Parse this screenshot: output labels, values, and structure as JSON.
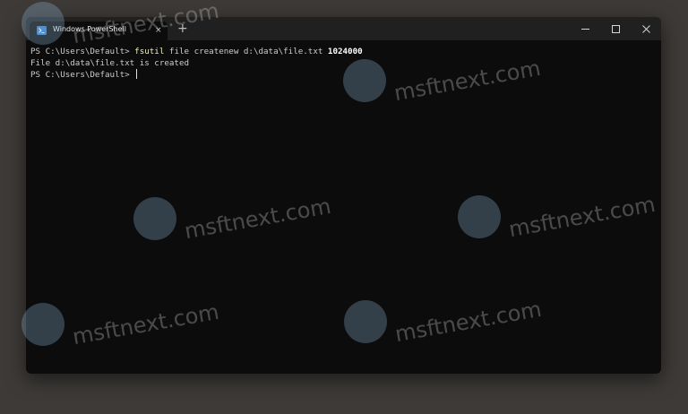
{
  "window": {
    "tab_title": "Windows PowerShell",
    "tab_close": "×",
    "new_tab": "+"
  },
  "terminal": {
    "line1": {
      "prompt": "PS C:\\Users\\Default> ",
      "command": "fsutil",
      "args": " file createnew d:\\data\\file.txt ",
      "size": "1024000"
    },
    "line2": "File d:\\data\\file.txt is created",
    "line3_prompt": "PS C:\\Users\\Default> "
  },
  "watermark": {
    "text": "msftnext.com"
  },
  "colors": {
    "terminal_bg": "#0c0c0c",
    "titlebar_bg": "#202020",
    "command": "#f9f1a5",
    "text": "#cccccc"
  }
}
